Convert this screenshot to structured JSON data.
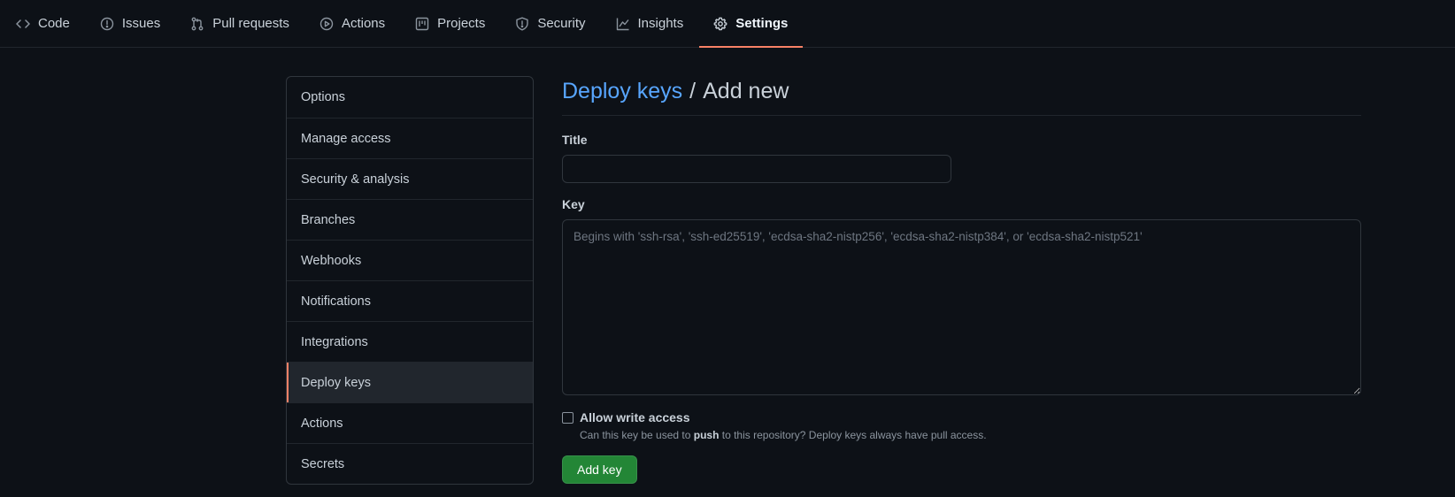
{
  "topnav": {
    "tabs": [
      {
        "label": "Code",
        "icon": "code-icon"
      },
      {
        "label": "Issues",
        "icon": "issue-opened-icon"
      },
      {
        "label": "Pull requests",
        "icon": "git-pull-request-icon"
      },
      {
        "label": "Actions",
        "icon": "play-icon"
      },
      {
        "label": "Projects",
        "icon": "project-icon"
      },
      {
        "label": "Security",
        "icon": "shield-icon"
      },
      {
        "label": "Insights",
        "icon": "graph-icon"
      },
      {
        "label": "Settings",
        "icon": "gear-icon",
        "active": true
      }
    ]
  },
  "sidebar": {
    "items": [
      {
        "label": "Options"
      },
      {
        "label": "Manage access"
      },
      {
        "label": "Security & analysis"
      },
      {
        "label": "Branches"
      },
      {
        "label": "Webhooks"
      },
      {
        "label": "Notifications"
      },
      {
        "label": "Integrations"
      },
      {
        "label": "Deploy keys",
        "active": true
      },
      {
        "label": "Actions"
      },
      {
        "label": "Secrets"
      }
    ]
  },
  "main": {
    "breadcrumb_link": "Deploy keys",
    "breadcrumb_sep": "/",
    "breadcrumb_current": "Add new",
    "title_label": "Title",
    "title_value": "",
    "key_label": "Key",
    "key_placeholder": "Begins with 'ssh-rsa', 'ssh-ed25519', 'ecdsa-sha2-nistp256', 'ecdsa-sha2-nistp384', or 'ecdsa-sha2-nistp521'",
    "write_access_label": "Allow write access",
    "write_access_note_pre": "Can this key be used to ",
    "write_access_note_bold": "push",
    "write_access_note_post": " to this repository? Deploy keys always have pull access.",
    "add_button": "Add key"
  },
  "colors": {
    "accent_underline": "#f78166",
    "link": "#58a6ff",
    "primary_button": "#238636",
    "background": "#0d1117"
  }
}
